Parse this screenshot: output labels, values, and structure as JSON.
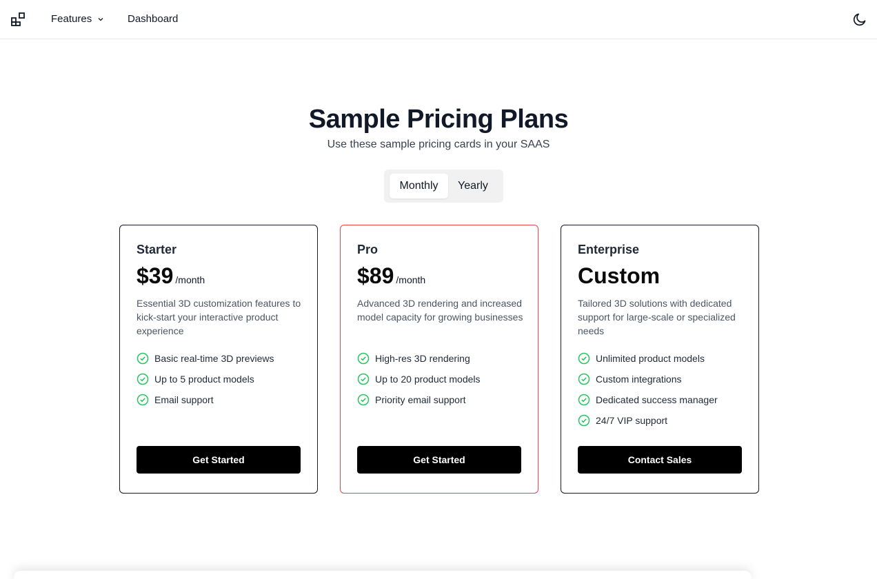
{
  "header": {
    "logo_icon": "blocks-icon",
    "nav": {
      "features_label": "Features",
      "dashboard_label": "Dashboard"
    },
    "theme_icon": "moon-icon"
  },
  "hero": {
    "title": "Sample Pricing Plans",
    "subtitle": "Use these sample pricing cards in your SAAS"
  },
  "billing_toggle": {
    "selected": "Monthly",
    "options": [
      "Monthly",
      "Yearly"
    ]
  },
  "colors": {
    "accent_border": "#ef4444",
    "check_icon": "#22c55e",
    "button_bg": "#000000"
  },
  "plans": [
    {
      "name": "Starter",
      "price": "$39",
      "period": "/month",
      "description": "Essential 3D customization features to kick-start your interactive product experience",
      "features": [
        "Basic real-time 3D previews",
        "Up to 5 product models",
        "Email support"
      ],
      "cta": "Get Started"
    },
    {
      "name": "Pro",
      "price": "$89",
      "period": "/month",
      "description": "Advanced 3D rendering and increased model capacity for growing businesses",
      "features": [
        "High-res 3D rendering",
        "Up to 20 product models",
        "Priority email support"
      ],
      "cta": "Get Started"
    },
    {
      "name": "Enterprise",
      "price": "Custom",
      "period": "",
      "description": "Tailored 3D solutions with dedicated support for large-scale or specialized needs",
      "features": [
        "Unlimited product models",
        "Custom integrations",
        "Dedicated success manager",
        "24/7 VIP support"
      ],
      "cta": "Contact Sales"
    }
  ]
}
